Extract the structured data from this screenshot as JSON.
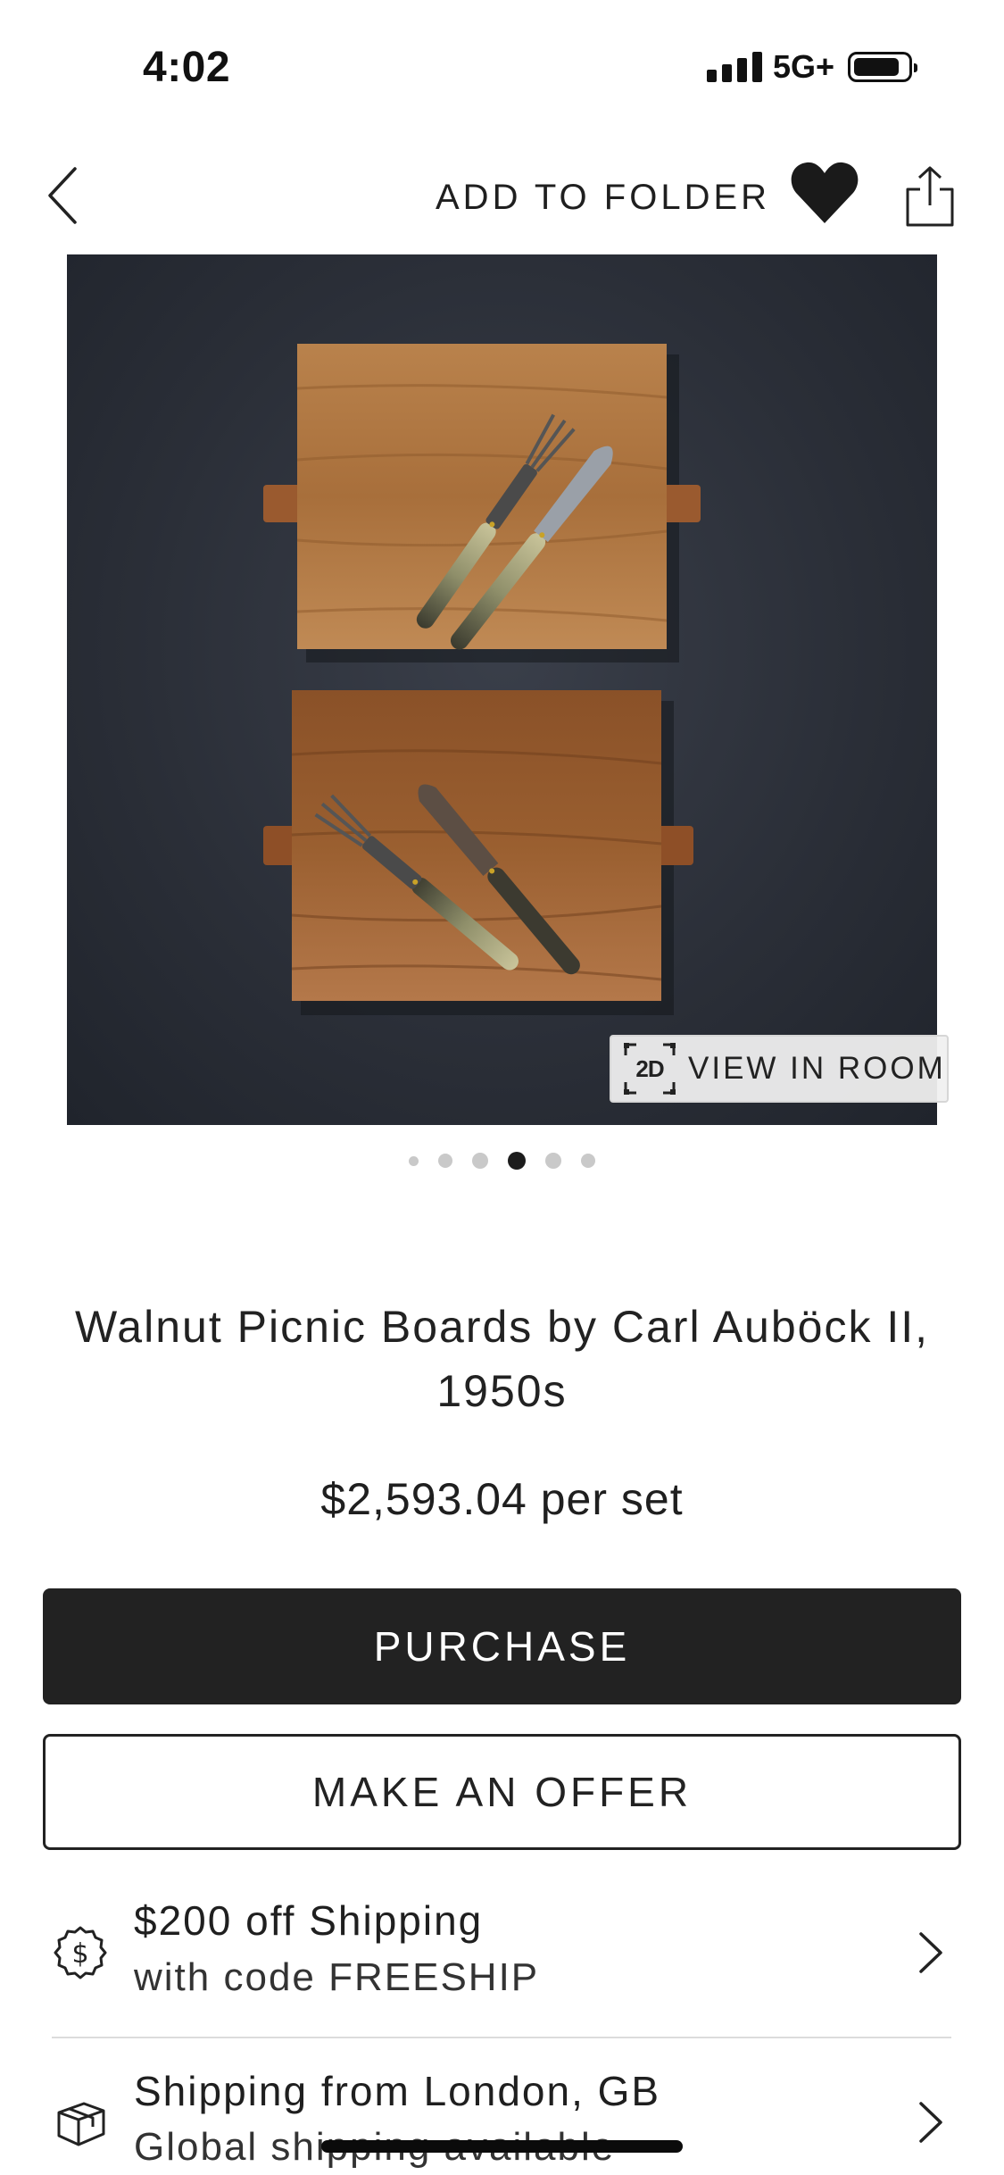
{
  "status_bar": {
    "time": "4:02",
    "network": "5G+"
  },
  "nav": {
    "add_to_folder": "ADD TO FOLDER",
    "back_icon": "chevron-left-icon",
    "favorite_icon": "heart-icon",
    "share_icon": "share-icon"
  },
  "hero": {
    "view_in_room_badge": "2D",
    "view_in_room": "VIEW IN ROOM"
  },
  "carousel": {
    "count": 6,
    "active_index": 3
  },
  "product": {
    "title": "Walnut Picnic Boards by Carl Auböck II, 1950s",
    "price": "$2,593.04 per set"
  },
  "actions": {
    "purchase": "PURCHASE",
    "offer": "MAKE AN OFFER"
  },
  "info_rows": [
    {
      "icon": "dollar-badge-icon",
      "title": "$200 off Shipping",
      "subtitle": "with code FREESHIP"
    },
    {
      "icon": "package-icon",
      "title": "Shipping from London, GB",
      "subtitle": "Global shipping available"
    }
  ],
  "colors": {
    "primary_button": "#222222",
    "text": "#1f1f1f",
    "divider": "#dcdcdc"
  }
}
